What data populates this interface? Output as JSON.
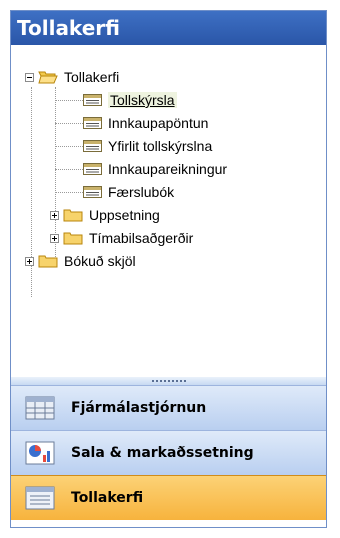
{
  "header": {
    "title": "Tollakerfi"
  },
  "tree": {
    "root_label": "Tollakerfi",
    "items": [
      {
        "label": "Tollskýrsla"
      },
      {
        "label": "Innkaupapöntun"
      },
      {
        "label": "Yfirlit tollskýrslna"
      },
      {
        "label": "Innkaupareikningur"
      },
      {
        "label": "Færslubók"
      }
    ],
    "folders": [
      {
        "label": "Uppsetning"
      },
      {
        "label": "Tímabilsaðgerðir"
      }
    ],
    "second_root_label": "Bókuð skjöl"
  },
  "nav": {
    "buttons": [
      {
        "label": "Fjármálastjórnun"
      },
      {
        "label": "Sala & markaðssetning"
      },
      {
        "label": "Tollakerfi"
      }
    ]
  }
}
